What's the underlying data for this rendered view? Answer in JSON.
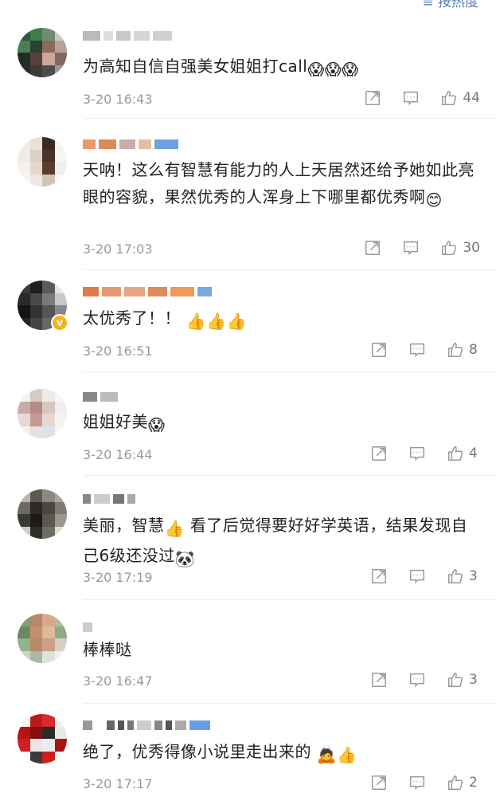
{
  "header": {
    "sort_label": "≡ 按热度"
  },
  "comments": [
    {
      "text": "为高知自信自强美女姐姐打call",
      "emoji": "😱😱😱",
      "time": "3-20 16:43",
      "likes": "44",
      "verified": false
    },
    {
      "text": "天呐！这么有智慧有能力的人上天居然还给予她如此亮眼的容貌，果然优秀的人浑身上下哪里都优秀啊",
      "emoji": "😊",
      "time": "3-20 17:03",
      "likes": "30",
      "verified": false
    },
    {
      "text": "太优秀了！！",
      "emoji": "👍👍👍",
      "time": "3-20 16:51",
      "likes": "8",
      "verified": true
    },
    {
      "text": "姐姐好美",
      "emoji": "😱",
      "time": "3-20 16:44",
      "likes": "4",
      "verified": false
    },
    {
      "text_a": "美丽，智慧",
      "emoji_a": "👍",
      "text_b": "看了后觉得要好好学英语，结果发现自己6级还没过",
      "emoji": "🐼",
      "time": "3-20 17:19",
      "likes": "3",
      "verified": false
    },
    {
      "text": "棒棒哒",
      "emoji": "",
      "time": "3-20 16:47",
      "likes": "3",
      "verified": false
    },
    {
      "text": "绝了，优秀得像小说里走出来的",
      "emoji": "🙇👍",
      "time": "3-20 17:17",
      "likes": "2",
      "verified": false
    }
  ],
  "icons": {
    "share": "share-icon",
    "comment": "comment-icon",
    "like": "like-icon"
  },
  "colors": {
    "link": "#5b7fb6",
    "meta": "#999999",
    "text": "#222222"
  }
}
